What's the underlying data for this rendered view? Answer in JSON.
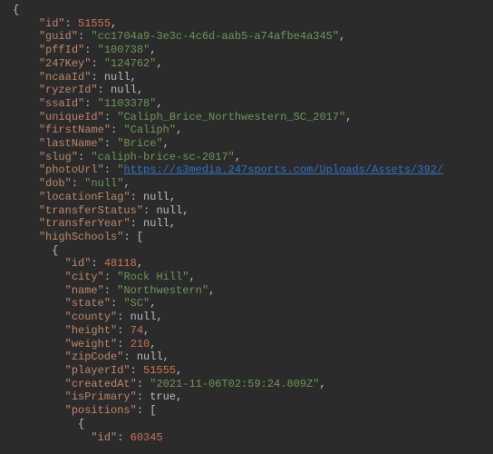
{
  "json_display": {
    "id": 51555,
    "guid": "cc1704a9-3e3c-4c6d-aab5-a74afbe4a345",
    "pffId": "100738",
    "247Key": "124762",
    "ncaaId": null,
    "ryzerId": null,
    "ssaId": "1103378",
    "uniqueId": "Caliph_Brice_Northwestern_SC_2017",
    "firstName": "Caliph",
    "lastName": "Brice",
    "slug": "caliph-brice-sc-2017",
    "photoUrl": "https://s3media.247sports.com/Uploads/Assets/392/",
    "dob": "null",
    "locationFlag": null,
    "transferStatus": null,
    "transferYear": null,
    "highSchools": [
      {
        "id": 48118,
        "city": "Rock Hill",
        "name": "Northwestern",
        "state": "SC",
        "county": null,
        "height": 74,
        "weight": 210,
        "zipCode": null,
        "playerId": 51555,
        "createdAt": "2021-11-06T02:59:24.809Z",
        "isPrimary": true,
        "positions": [
          {
            "id": 60345
          }
        ]
      }
    ]
  },
  "labels": {
    "id": "id",
    "guid": "guid",
    "pffId": "pffId",
    "247Key": "247Key",
    "ncaaId": "ncaaId",
    "ryzerId": "ryzerId",
    "ssaId": "ssaId",
    "uniqueId": "uniqueId",
    "firstName": "firstName",
    "lastName": "lastName",
    "slug": "slug",
    "photoUrl": "photoUrl",
    "dob": "dob",
    "locationFlag": "locationFlag",
    "transferStatus": "transferStatus",
    "transferYear": "transferYear",
    "highSchools": "highSchools",
    "city": "city",
    "name": "name",
    "state": "state",
    "county": "county",
    "height": "height",
    "weight": "weight",
    "zipCode": "zipCode",
    "playerId": "playerId",
    "createdAt": "createdAt",
    "isPrimary": "isPrimary",
    "positions": "positions",
    "null": "null",
    "true": "true"
  }
}
